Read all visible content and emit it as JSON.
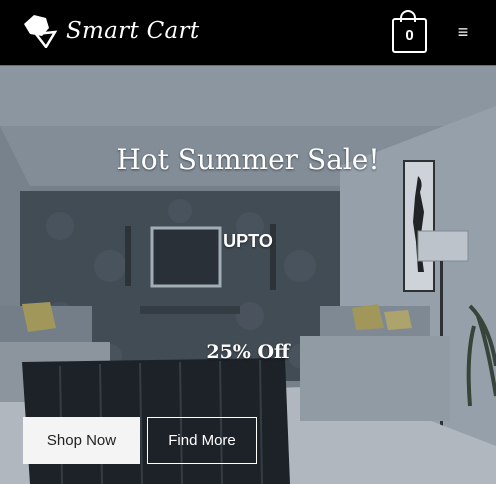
{
  "header": {
    "brand": "Smart Cart",
    "logo_icon": "cube-logo-icon",
    "cart_icon": "shopping-bag-icon",
    "cart_count": "0",
    "menu_icon": "hamburger-menu-icon",
    "menu_glyph": "≡"
  },
  "hero": {
    "headline": "Hot Summer Sale!",
    "upto": "UPTO",
    "offer": "25% Off",
    "background": "living-room-photo",
    "buttons": {
      "shop_now": "Shop Now",
      "find_more": "Find More"
    }
  },
  "colors": {
    "header_bg": "#000000",
    "hero_tint": "#7d8791",
    "primary_button_bg": "#f4f4f4",
    "text_light": "#ffffff"
  }
}
